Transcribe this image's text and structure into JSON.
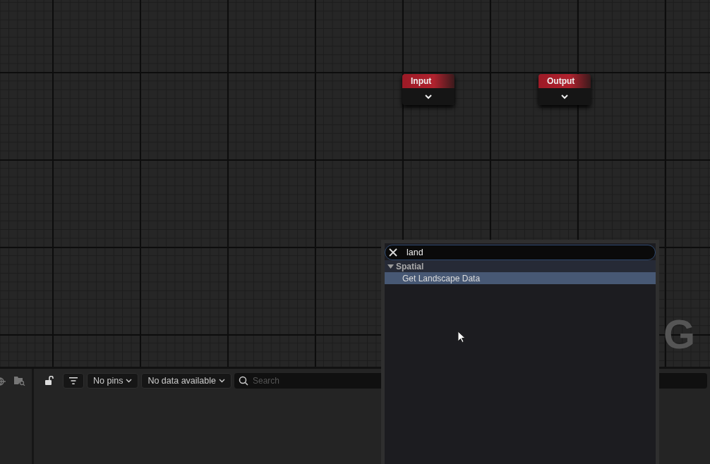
{
  "graph": {
    "nodes": [
      {
        "title": "Input"
      },
      {
        "title": "Output"
      }
    ],
    "corner_text": "G"
  },
  "details_panel": {
    "pins_dropdown": "No pins",
    "data_dropdown": "No data available",
    "search": {
      "placeholder": "Search"
    }
  },
  "node_menu": {
    "search": {
      "value": "land"
    },
    "categories": [
      {
        "label": "Spatial",
        "expanded": true,
        "children": [
          {
            "label": "Get Landscape Data",
            "selected": true
          }
        ]
      }
    ]
  }
}
